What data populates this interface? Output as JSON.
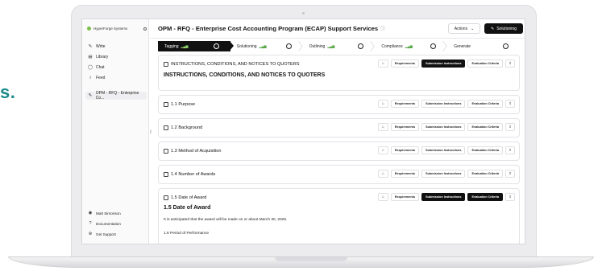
{
  "background_text": "s.",
  "sidebar": {
    "brand": "HyperForge Systems",
    "items": [
      {
        "label": "Write",
        "icon": "pen-icon"
      },
      {
        "label": "Library",
        "icon": "book-icon"
      },
      {
        "label": "Chat",
        "icon": "chat-icon"
      },
      {
        "label": "Feed",
        "icon": "rss-icon"
      }
    ],
    "active_project": "OPM - RFQ - Enterprise Co...",
    "bottom": [
      {
        "label": "Matt Simonson",
        "icon": "user-icon"
      },
      {
        "label": "Documentation",
        "icon": "help-icon"
      },
      {
        "label": "Get Support",
        "icon": "support-icon"
      }
    ]
  },
  "header": {
    "title": "OPM - RFQ - Enterprise Cost Accounting Program (ECAP) Support Services",
    "actions_label": "Actions",
    "solutioning_label": "Solutioning"
  },
  "stepper": [
    {
      "label": "Tagging",
      "current": true
    },
    {
      "label": "Solutioning",
      "current": false
    },
    {
      "label": "Outlining",
      "current": false
    },
    {
      "label": "Compliance",
      "current": false
    },
    {
      "label": "Generate",
      "current": false
    }
  ],
  "button_labels": {
    "requirements": "Requirements",
    "submission": "Submission Instructions",
    "evaluation": "Evaluation Criteria"
  },
  "sections": [
    {
      "label": "INSTRUCTIONS, CONDITIONS, AND NOTICES TO QUOTERS",
      "heading": "INSTRUCTIONS, CONDITIONS, AND NOTICES TO QUOTERS",
      "dark_submission": true,
      "dark_evaluation": false
    },
    {
      "label": "1.1 Purpose",
      "dark_submission": false,
      "dark_evaluation": false
    },
    {
      "label": "1.2 Background",
      "dark_submission": false,
      "dark_evaluation": false
    },
    {
      "label": "1.3 Method of Acquisition",
      "dark_submission": false,
      "dark_evaluation": false
    },
    {
      "label": "1.4 Number of Awards",
      "dark_submission": false,
      "dark_evaluation": false
    },
    {
      "label": "1.5 Date of Award",
      "heading": "1.5 Date of Award",
      "body": "It is anticipated that the award will be made on or about March 30, 2025.",
      "subheading": "1.6 Period of Performance",
      "dark_submission": true,
      "dark_evaluation": true
    }
  ],
  "colors": {
    "accent": "#111111",
    "signal": "#5aa84a",
    "brand_text": "#1a8a8a"
  }
}
